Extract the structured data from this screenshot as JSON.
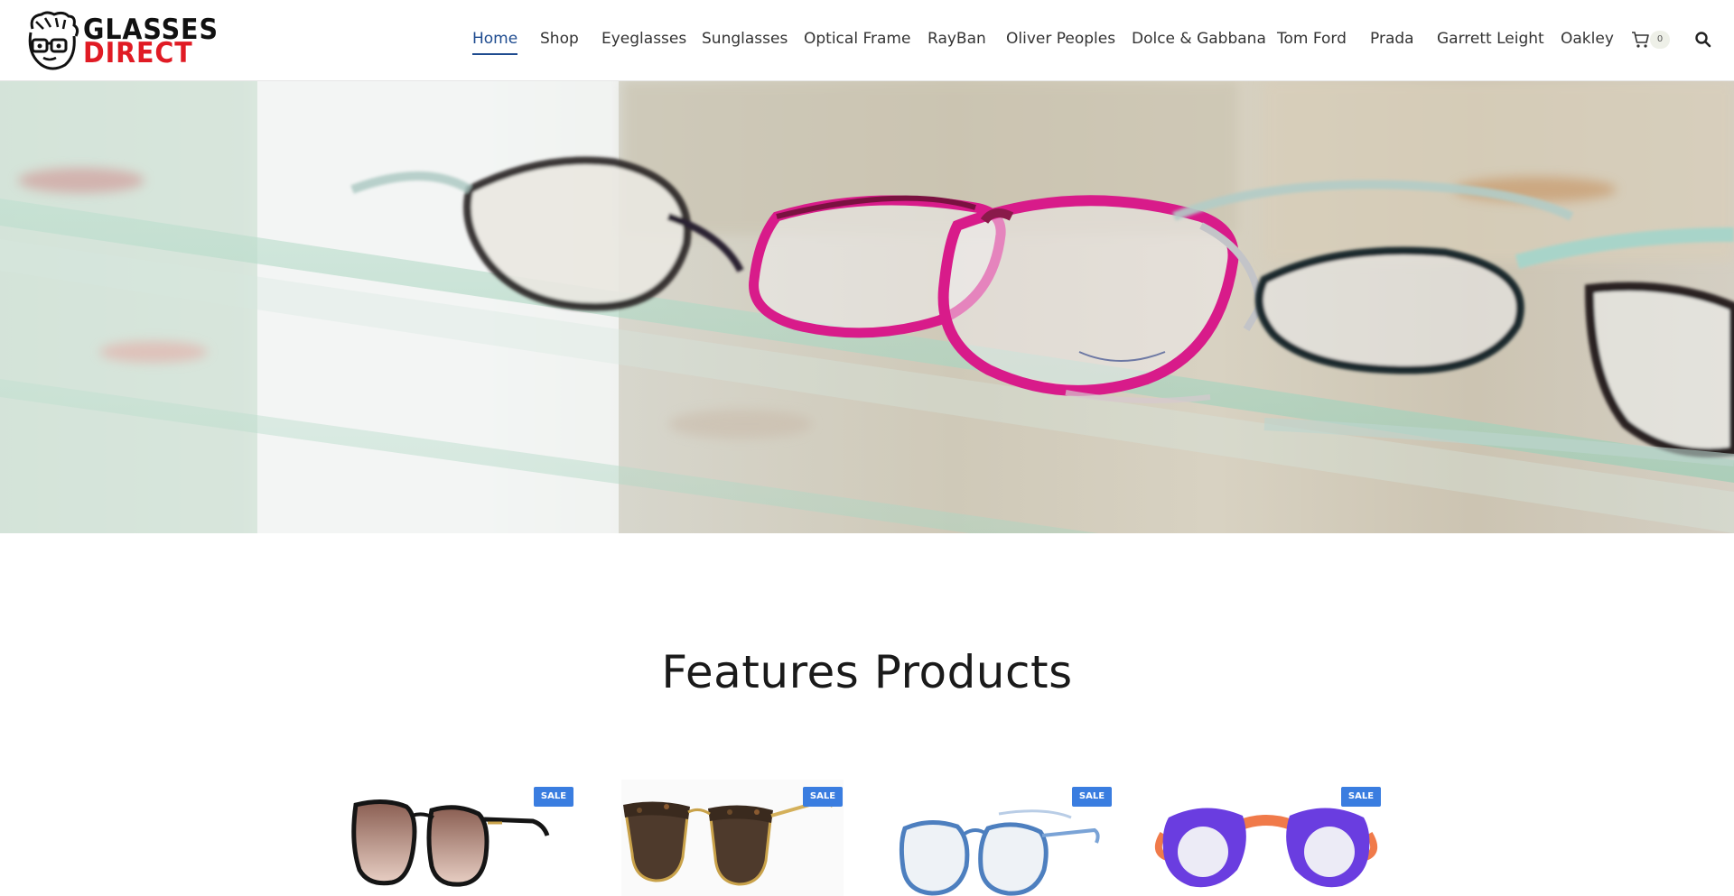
{
  "brand": {
    "logo_line1": "GLASSES",
    "logo_line2": "DIRECT",
    "accent_color": "#e01b24"
  },
  "nav": {
    "items": [
      {
        "label": "Home",
        "active": true
      },
      {
        "label": "Shop"
      },
      {
        "label": "Eyeglasses"
      },
      {
        "label": "Sunglasses"
      },
      {
        "label": "Optical Frame"
      },
      {
        "label": "RayBan"
      },
      {
        "label": "Oliver Peoples"
      },
      {
        "label": "Dolce & Gabbana"
      },
      {
        "label": "Tom Ford"
      },
      {
        "label": "Prada"
      },
      {
        "label": "Garrett Leight"
      },
      {
        "label": "Oakley"
      }
    ],
    "cart_count": "0",
    "cart_icon": "cart-icon",
    "search_icon": "search-icon",
    "active_color": "#1e4b8f"
  },
  "features": {
    "title": "Features Products",
    "products": [
      {
        "badge": "SALE"
      },
      {
        "badge": "SALE"
      },
      {
        "badge": "SALE"
      },
      {
        "badge": "SALE"
      }
    ],
    "badge_color": "#3a7de0"
  }
}
